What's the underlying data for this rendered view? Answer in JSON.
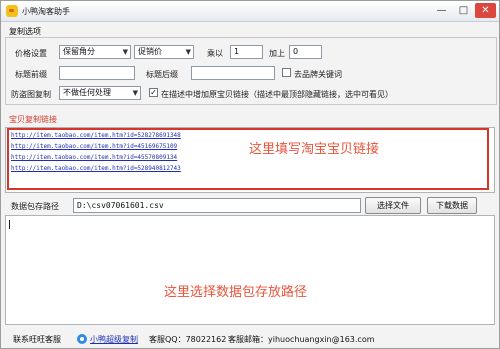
{
  "window": {
    "title": "小鸭淘客助手",
    "minimize_glyph": "—",
    "maximize_glyph": "□",
    "close_glyph": "✕"
  },
  "copy_options": {
    "section_title": "复制选项",
    "price_setting_label": "价格设置",
    "price_mode_value": "保留角分",
    "price_source_value": "促销价",
    "multiply_label": "乘以",
    "multiply_value": "1",
    "add_label": "加上",
    "add_value": "0",
    "title_prefix_label": "标题前缀",
    "title_prefix_value": "",
    "title_suffix_label": "标题后缀",
    "title_suffix_value": "",
    "remove_brand_label": "去品牌关键词",
    "remove_brand_checked": false,
    "anti_theft_label": "防盗图复制",
    "anti_theft_value": "不做任何处理",
    "add_link_checked": true,
    "add_link_label": "在描述中增加原宝贝链接（描述中最顶部隐藏链接，选中可看见）"
  },
  "links_section": {
    "title": "宝贝复制链接",
    "links": [
      "http://item.taobao.com/item.htm?id=528278691348",
      "http://item.taobao.com/item.htm?id=45169675109",
      "http://item.taobao.com/item.htm?id=45570809134",
      "http://item.taobao.com/item.htm?id=528940812743"
    ],
    "callout": "这里填写淘宝宝贝链接"
  },
  "save_path": {
    "label": "数据包存路径",
    "value": "D:\\csv07061601.csv",
    "choose_button": "选择文件",
    "download_button": "下载数据",
    "callout": "这里选择数据包存放路径"
  },
  "status_bar": {
    "contact_label": "联系旺旺客服",
    "link_text": "小鸭超级复制",
    "qq_text": "客服QQ：78022162",
    "email_text": "客服邮箱：yihuochuangxin@163.com"
  },
  "colors": {
    "accent_red": "#d8342a",
    "link_blue": "#1f2fb3",
    "callout_orange": "#e8553c"
  }
}
